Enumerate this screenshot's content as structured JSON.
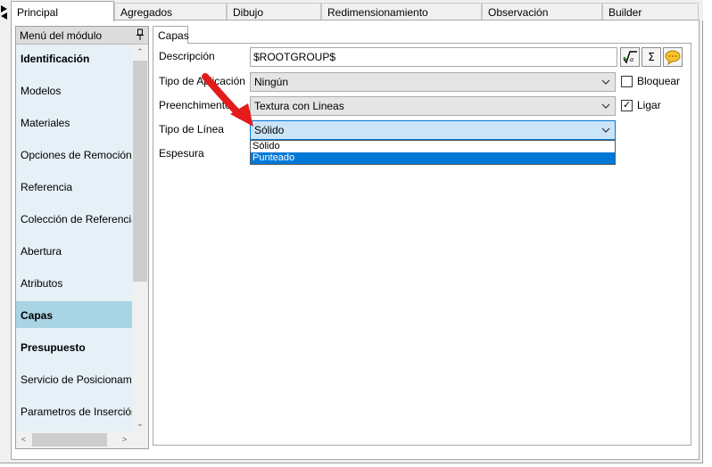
{
  "tabs": [
    {
      "label": "Principal",
      "active": true
    },
    {
      "label": "Agregados",
      "active": false
    },
    {
      "label": "Dibujo",
      "active": false
    },
    {
      "label": "Redimensionamiento",
      "active": false
    },
    {
      "label": "Observación",
      "active": false
    },
    {
      "label": "Builder",
      "active": false
    }
  ],
  "menu": {
    "header": "Menú del módulo",
    "items": [
      {
        "label": "Identificación",
        "bold": true
      },
      {
        "label": "Modelos",
        "bold": false
      },
      {
        "label": "Materiales",
        "bold": false
      },
      {
        "label": "Opciones de Remoción",
        "bold": false
      },
      {
        "label": "Referencia",
        "bold": false
      },
      {
        "label": "Colección de Referencias",
        "bold": false
      },
      {
        "label": "Abertura",
        "bold": false
      },
      {
        "label": "Atributos",
        "bold": false
      },
      {
        "label": "Capas",
        "bold": true,
        "selected": true
      },
      {
        "label": "Presupuesto",
        "bold": true
      },
      {
        "label": "Servicio de Posicionamiento",
        "bold": false
      },
      {
        "label": "Parametros de Inserción",
        "bold": false
      }
    ]
  },
  "panel": {
    "tab_label": "Capas",
    "fields": {
      "descripcion_label": "Descripción",
      "descripcion_value": "$ROOTGROUP$",
      "tipo_aplicacion_label": "Tipo de Aplicación",
      "tipo_aplicacion_value": "Ningún",
      "preenchimento_label": "Preenchimento",
      "preenchimento_value": "Textura con Lineas",
      "tipo_linea_label": "Tipo de Línea",
      "tipo_linea_value": "Sólido",
      "espesura_label": "Espesura"
    },
    "dropdown_options": [
      "Sólido",
      "Punteado"
    ],
    "checkboxes": {
      "bloquear_label": "Bloquear",
      "bloquear_checked": false,
      "ligar_label": "Ligar",
      "ligar_checked": true
    },
    "icons": {
      "formula": "formula-icon",
      "sum": "sum-icon",
      "comment": "comment-icon"
    }
  },
  "colors": {
    "accent": "#0078d7",
    "selected_menu": "#a8d4e4",
    "menu_bg": "#e6f0f7",
    "annotation_arrow": "#e31b1b"
  }
}
